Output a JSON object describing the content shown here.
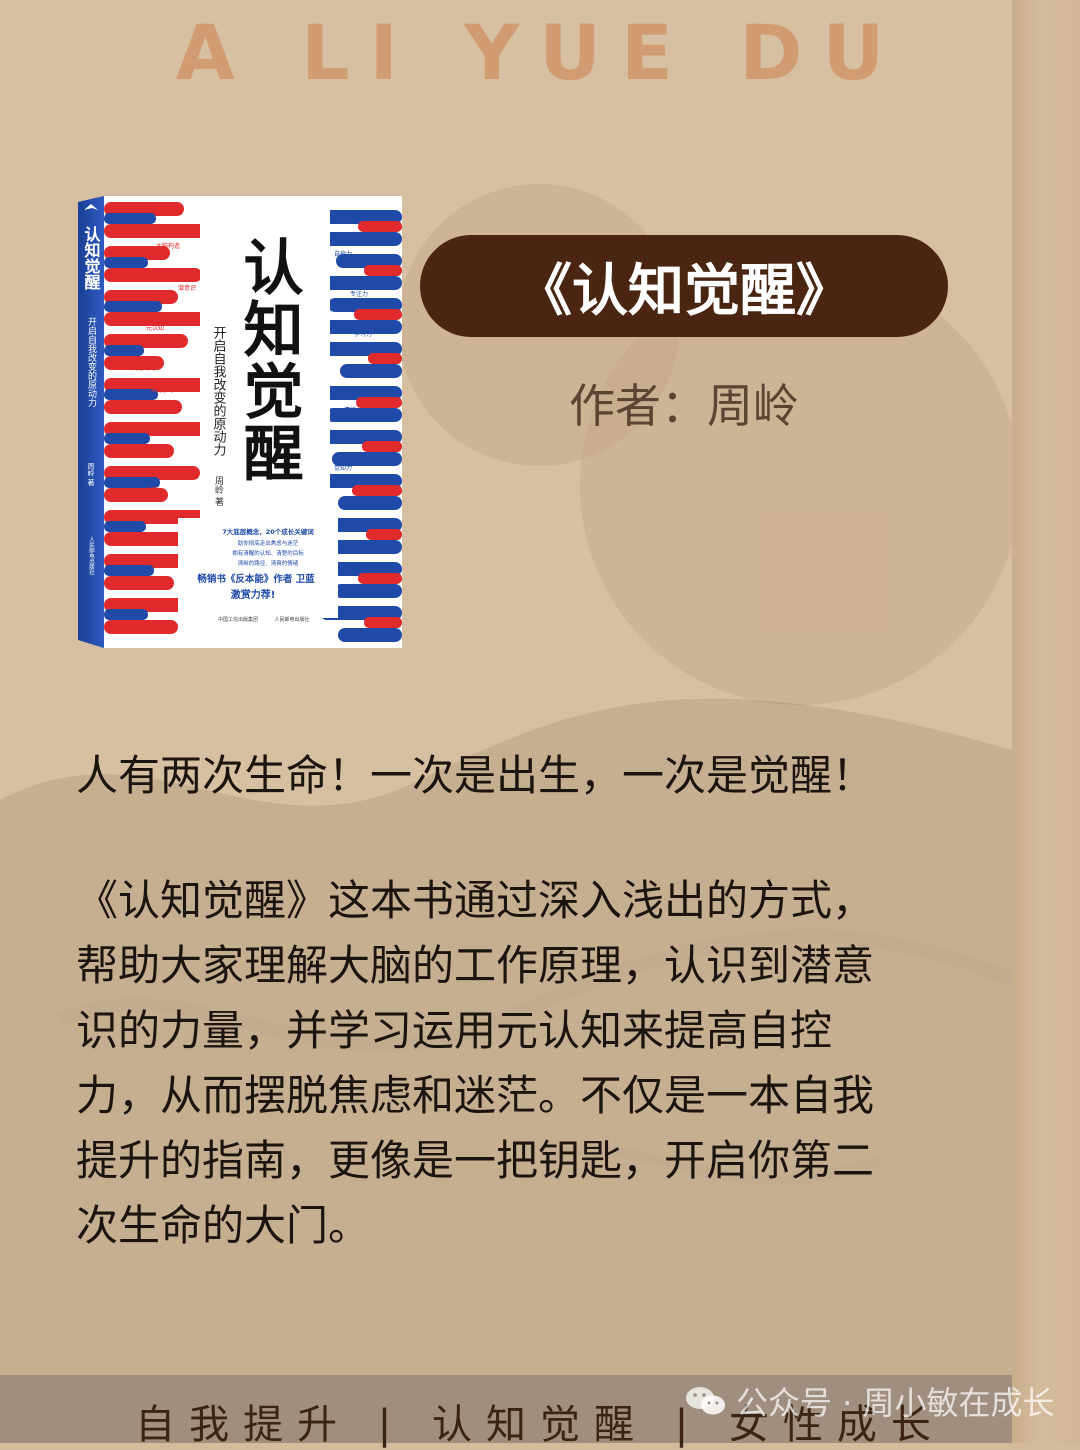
{
  "header": {
    "brand": "A LI YUE DU"
  },
  "book": {
    "cover_title": "认知觉醒",
    "cover_subtitle": "开启自我改变的原动力",
    "cover_author": "周岭 著",
    "spine_title": "认知觉醒",
    "spine_subtitle": "开启自我改变的原动力",
    "spine_author": "周岭 著",
    "spine_publisher": "人民邮电出版社",
    "tags_left": [
      "大脑构造",
      "潜意识",
      "元认知",
      "刻意练习",
      "深度学习",
      "关联",
      "反馈"
    ],
    "tags_right": [
      "自控力",
      "专注力",
      "学习力",
      "行动力",
      "情绪力",
      "觉知力"
    ],
    "blurb_line1": "7大底层概念，20个成长关键词",
    "blurb_line2": "助你彻底走出焦虑与迷茫",
    "blurb_line3": "拥有清醒的认知、清楚的目标",
    "blurb_line4": "清晰的路径、清爽的情绪",
    "blurb_rec1": "畅销书《反本能》作者 卫蓝",
    "blurb_rec2": "激赏力荐!",
    "publisher_left": "中国工信出版集团",
    "publisher_right": "人民邮电出版社",
    "colors": {
      "red": "#e12a2b",
      "blue": "#1f4aa8",
      "white": "#ffffff"
    }
  },
  "title": "《认知觉醒》",
  "author": "作者：周岭",
  "quote": "人有两次生命！一次是出生，一次是觉醒！",
  "body_lines": [
    "《认知觉醒》这本书通过深入浅出的方式，",
    "帮助大家理解大脑的工作原理，认识到潜意",
    "识的力量，并学习运用元认知来提高自控",
    "力，从而摆脱焦虑和迷茫。不仅是一本自我",
    "提升的指南，更像是一把钥匙，开启你第二",
    "次生命的大门。"
  ],
  "footer": {
    "tags": "自我提升 | 认知觉醒 | 女性成长"
  },
  "watermark": {
    "text": "公众号 · 周小敏在成长",
    "icon": "wechat-icon"
  },
  "colors": {
    "background": "#d7bfa1",
    "brand": "#d19c72",
    "pill": "#4a2512",
    "footer": "#a08e7e"
  }
}
